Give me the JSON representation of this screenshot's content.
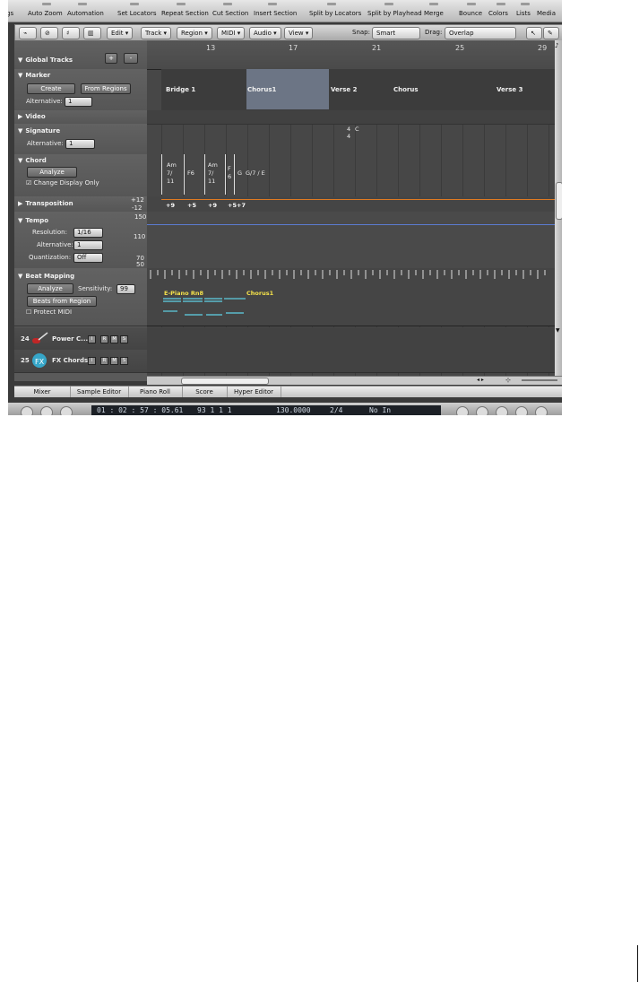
{
  "toolbar": {
    "items": [
      "gs",
      "Auto Zoom",
      "Automation",
      "Set Locators",
      "Repeat Section",
      "Cut Section",
      "Insert Section",
      "Split by Locators",
      "Split by Playhead",
      "Merge",
      "Bounce",
      "Colors",
      "Lists",
      "Media"
    ]
  },
  "menubar": {
    "edit": "Edit ▾",
    "track": "Track ▾",
    "region": "Region ▾",
    "midi": "MIDI ▾",
    "audio": "Audio ▾",
    "view": "View ▾",
    "snap_label": "Snap:",
    "snap_value": "Smart",
    "drag_label": "Drag:",
    "drag_value": "Overlap"
  },
  "global_tracks": {
    "title": "Global Tracks",
    "add": "+",
    "remove": "-",
    "marker": {
      "title": "Marker",
      "create": "Create",
      "from_regions": "From Regions",
      "alt_label": "Alternative:",
      "alt_value": "1"
    },
    "video": {
      "title": "Video"
    },
    "signature": {
      "title": "Signature",
      "alt_label": "Alternative:",
      "alt_value": "1"
    },
    "chord": {
      "title": "Chord",
      "analyze": "Analyze",
      "change_display": "Change Display Only"
    },
    "transposition": {
      "title": "Transposition",
      "max": "+12",
      "min": "-12"
    },
    "tempo": {
      "title": "Tempo",
      "resolution_label": "Resolution:",
      "resolution_value": "1/16",
      "alt_label": "Alternative:",
      "alt_value": "1",
      "quant_label": "Quantization:",
      "quant_value": "Off",
      "scale_150": "150",
      "scale_110": "110",
      "scale_70": "70",
      "scale_50": "50"
    },
    "beat_mapping": {
      "title": "Beat Mapping",
      "analyze": "Analyze",
      "sensitivity_label": "Sensitivity:",
      "sensitivity_value": "99",
      "beats_from_region": "Beats from Region",
      "protect_midi": "Protect MIDI"
    }
  },
  "tracks": [
    {
      "number": "24",
      "name": "Power C..."
    },
    {
      "number": "25",
      "name": "FX Chords"
    }
  ],
  "ruler": {
    "bars": [
      "13",
      "17",
      "21",
      "25",
      "29"
    ]
  },
  "markers": [
    "Bridge 1",
    "Chorus1",
    "Verse 2",
    "Chorus",
    "Verse 3"
  ],
  "signature_value": {
    "top": "4",
    "bottom": "4",
    "key": "C"
  },
  "chords": [
    {
      "lines": [
        "Am",
        "7/",
        "11"
      ]
    },
    {
      "lines": [
        "F6"
      ]
    },
    {
      "lines": [
        "Am",
        "7/",
        "11"
      ]
    },
    {
      "lines": [
        "F",
        "6"
      ]
    },
    {
      "lines": [
        "G"
      ]
    },
    {
      "lines": [
        "G/7 / E"
      ]
    }
  ],
  "transpositions": [
    "+9",
    "+5",
    "+9",
    "+5",
    "+7"
  ],
  "regions": [
    {
      "name": "E-Piano Rn8"
    },
    {
      "name": "Chorus1"
    }
  ],
  "tabs": [
    "Mixer",
    "Sample Editor",
    "Piano Roll",
    "Score",
    "Hyper Editor"
  ],
  "transport": {
    "position": "01 : 02 : 57 : 05.61",
    "bars": "93   1   1   1",
    "tempo": "130.0000",
    "signature": "2/4",
    "in": "No In"
  }
}
